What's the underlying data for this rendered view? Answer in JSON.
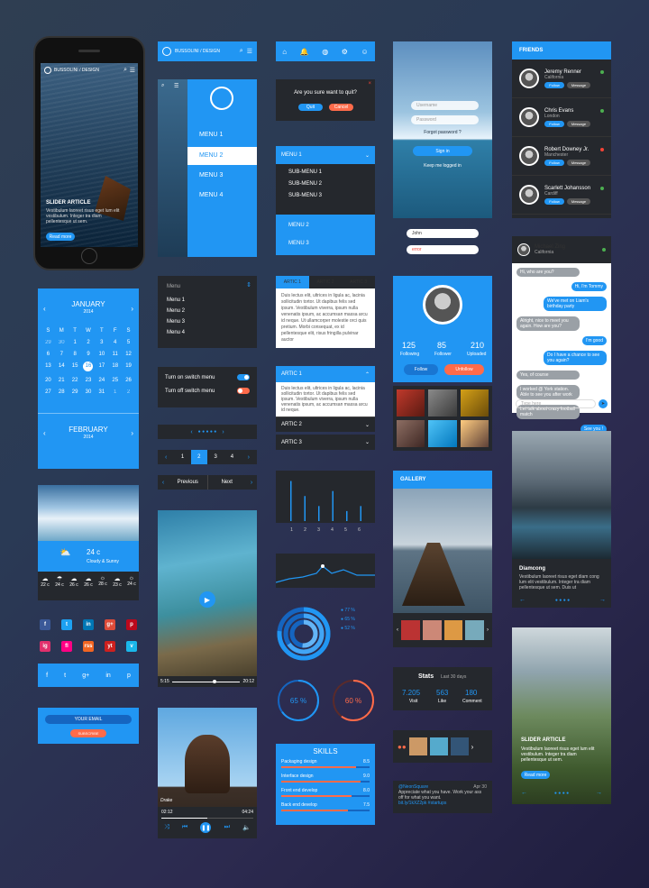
{
  "phone": {
    "brand": "BUSSOLINI / DESIGN",
    "article_title": "SLIDER ARTICLE",
    "article_text": "Vestibulum laoreet risus eget lum elit vestibulum. Integer tra diam pellentesque ut sem.",
    "read_more": "Read more"
  },
  "nav_bar": {
    "brand": "BUSSOLINI / DESIGN"
  },
  "side_menu": {
    "items": [
      "MENU 1",
      "MENU 2",
      "MENU 3",
      "MENU 4"
    ]
  },
  "quit_dialog": {
    "question": "Are you sure want to quit?",
    "quit": "Quit",
    "cancel": "Cancel"
  },
  "dropdown_menu": {
    "items": [
      "MENU 1",
      "SUB-MENU 1",
      "SUB-MENU 2",
      "SUB-MENU 3",
      "MENU 2",
      "MENU 3"
    ]
  },
  "login": {
    "username_placeholder": "Username",
    "password_placeholder": "Password",
    "forgot": "Forgot password ?",
    "signin": "Sign in",
    "keep": "Keep me logged in",
    "field_john": "John",
    "field_error": "error"
  },
  "friends": {
    "title": "FRIENDS",
    "list": [
      {
        "name": "Jeremy Renner",
        "city": "California",
        "status": "#4caf50"
      },
      {
        "name": "Chris Evans",
        "city": "London",
        "status": "#4caf50"
      },
      {
        "name": "Robert Downey Jr.",
        "city": "Manchester",
        "status": "#f44336"
      },
      {
        "name": "Scarlett Johansson",
        "city": "Cardiff",
        "status": "#4caf50"
      }
    ],
    "follow": "Follow",
    "message": "Message"
  },
  "calendar": {
    "month1": "JANUARY",
    "year1": "2014",
    "month2": "FEBRUARY",
    "year2": "2014",
    "weekdays": [
      "S",
      "M",
      "T",
      "W",
      "T",
      "F",
      "S"
    ],
    "days": [
      "29",
      "30",
      "1",
      "2",
      "3",
      "4",
      "5",
      "6",
      "7",
      "8",
      "9",
      "10",
      "11",
      "12",
      "13",
      "14",
      "15",
      "16",
      "17",
      "18",
      "19",
      "20",
      "21",
      "22",
      "23",
      "24",
      "25",
      "26",
      "27",
      "28",
      "29",
      "30",
      "31",
      "1",
      "2"
    ],
    "today": "16"
  },
  "menu_list": {
    "title": "Menu",
    "items": [
      "Menu 1",
      "Menu 2",
      "Menu 3",
      "Menu 4"
    ]
  },
  "tabs": {
    "labels": [
      "ARTIC 1",
      "ARTIC 2",
      "ARTIC 3"
    ],
    "text": "Duis lectus elit, ultrices in ligula ac, lacinia sollicitudin tortor. Ut dapibus felis sed ipsum. Vestibulum viverra, ipsum nulla venenatis ipsum, ac accumsan massa arcu id neque. Ut ullamcorper molestie orci quis pretium. Morbi consequat, ex id pellentesque elit, risus fringilla pulvinar auctor"
  },
  "profile": {
    "following": "125",
    "following_label": "Following",
    "follower": "85",
    "follower_label": "Follower",
    "uploaded": "210",
    "uploaded_label": "Uploaded",
    "follow": "Follow",
    "unfollow": "Unfollow"
  },
  "chat": {
    "name": "Michael Zing",
    "city": "California",
    "messages": [
      {
        "side": "l",
        "text": "Hi, who are you?"
      },
      {
        "side": "r",
        "text": "Hi, I'm Tommy"
      },
      {
        "side": "r",
        "text": "We've met on Liam's birthday party"
      },
      {
        "side": "l",
        "text": "Alright, nice to meet you again. How are you?"
      },
      {
        "side": "r",
        "text": "I'm good"
      },
      {
        "side": "r",
        "text": "Do I have a chance to see you again?"
      },
      {
        "side": "l",
        "text": "Yes, of course"
      },
      {
        "side": "l",
        "text": "I worked @ York station. Able to see you after work"
      },
      {
        "side": "l",
        "text": "Let talk about crazy football match"
      },
      {
        "side": "r",
        "text": "See you !"
      }
    ],
    "placeholder": "Type here"
  },
  "switches": {
    "on_label": "Turn on switch menu",
    "off_label": "Turn off switch menu"
  },
  "accordion": {
    "open": "ARTIC 1",
    "text": "Duis lectus elit, ultrices in ligula ac, lacinia sollicitudin tortor. Ut dapibus felis sed ipsum. Vestibulum viverra, ipsum nulla venenatis ipsum, ac accumsan massa arcu id neque.",
    "closed": [
      "ARTIC 2",
      "ARTIC 3"
    ]
  },
  "pagination": {
    "pages": [
      "1",
      "2",
      "3",
      "4"
    ],
    "active": "2",
    "prev": "Previous",
    "next": "Next"
  },
  "bar_chart": {
    "type": "bar",
    "categories": [
      "1",
      "2",
      "3",
      "4",
      "5",
      "6"
    ],
    "values": [
      40,
      25,
      15,
      30,
      10,
      15
    ]
  },
  "gallery": {
    "title": "GALLERY"
  },
  "mountain": {
    "title": "Diamcong",
    "text": "Vestibulum laoreet risus eget diam cong lum elit vestibulum. Integer tra diam pellentesque ut sem. Duis ut"
  },
  "weather": {
    "temp": "24 c",
    "desc": "Cloudy & Sunny",
    "days": [
      {
        "t": "22 c"
      },
      {
        "t": "24 c"
      },
      {
        "t": "26 c"
      },
      {
        "t": "26 c"
      },
      {
        "t": "28 c"
      },
      {
        "t": "23 c"
      },
      {
        "t": "24 c"
      }
    ]
  },
  "video": {
    "time_start": "5:15",
    "time_end": "20:12"
  },
  "donut": {
    "legend": [
      "77 %",
      "65 %",
      "52 %"
    ]
  },
  "circles": {
    "c1": "65 %",
    "c2": "60 %"
  },
  "stats": {
    "title": "Stats",
    "period": "Last 30 days",
    "visit": "7.205",
    "visit_label": "Visit",
    "like": "563",
    "like_label": "Like",
    "comment": "180",
    "comment_label": "Comment"
  },
  "social": {
    "row1": [
      "f",
      "t",
      "in",
      "g+",
      "p"
    ],
    "row2": [
      "ig",
      "fl",
      "rss",
      "yt",
      "v"
    ],
    "row3": [
      "f",
      "t",
      "g+",
      "in",
      "p"
    ]
  },
  "newsletter": {
    "label": "YOUR EMAIL",
    "button": "SUBSCRIBE"
  },
  "music": {
    "artist": "Drake",
    "time_start": "02:12",
    "time_end": "04:24"
  },
  "skills": {
    "title": "SKILLS",
    "items": [
      {
        "name": "Packaging design",
        "val": "8.5"
      },
      {
        "name": "Interface design",
        "val": "9.0"
      },
      {
        "name": "Front end develop",
        "val": "8.0"
      },
      {
        "name": "Back end develop",
        "val": "7.5"
      }
    ]
  },
  "tweet": {
    "handle": "@NeonSquare",
    "date": "Apr 30",
    "text": "Appreciate what you have. Work your ass off for what you want.",
    "link": "bit.ly/1kXZ2pk #startups"
  },
  "slider2": {
    "title": "SLIDER ARTICLE",
    "text": "Vestibulum laoreet risus eget lum elit vestibulum. Integer tra diam pellentesque ut sem.",
    "read_more": "Read more"
  }
}
